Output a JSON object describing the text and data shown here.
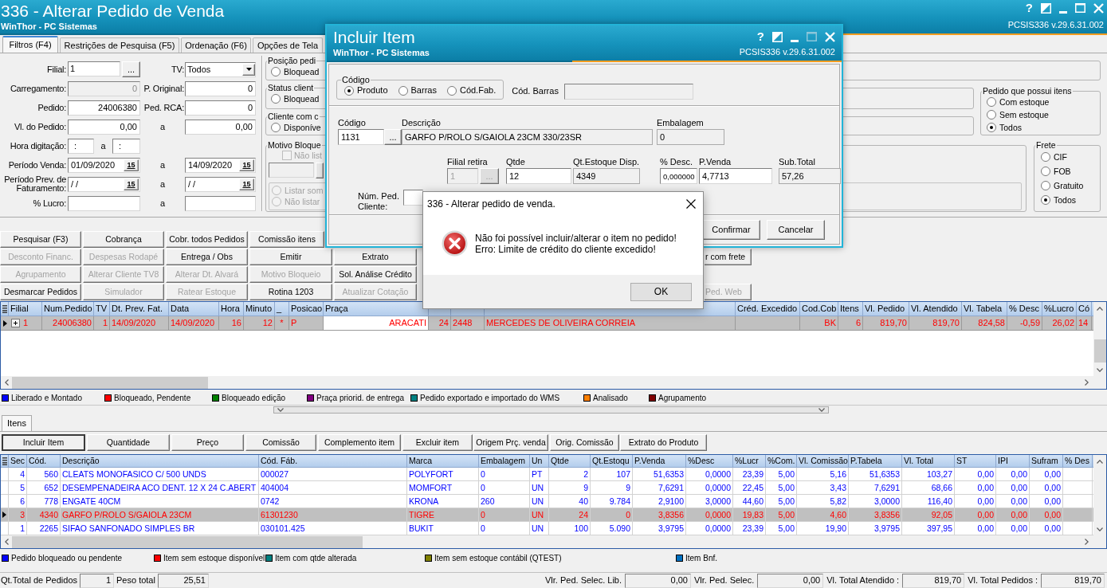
{
  "window": {
    "title": "336 - Alterar Pedido de Venda",
    "subtitle": "WinThor - PC Sistemas",
    "help": "?",
    "buttons": [
      {
        "kind": "restore",
        "disabled": false
      },
      {
        "kind": "minimize",
        "disabled": false
      },
      {
        "kind": "maximize",
        "disabled": false
      },
      {
        "kind": "close",
        "disabled": false
      }
    ],
    "version": "PCSIS336 v.29.6.31.002"
  },
  "tabs": [
    {
      "label": "Filtros (F4)",
      "selected": true
    },
    {
      "label": "Restrições de Pesquisa (F5)",
      "selected": false
    },
    {
      "label": "Ordenação (F6)",
      "selected": false
    },
    {
      "label": "Opções de Tela",
      "selected": false
    }
  ],
  "filters": [
    {
      "left": {
        "label": "Filial:",
        "kind": "lookup",
        "value": "1",
        "button": "...",
        "disabled": false
      },
      "right": {
        "label": "TV:",
        "kind": "select",
        "value": "Todos",
        "disabled": false,
        "range_end": false
      }
    },
    {
      "left": {
        "label": "Carregamento:",
        "kind": "number",
        "value": "0",
        "disabled": true
      },
      "right": {
        "label": "P. Original:",
        "kind": "number",
        "value": "0",
        "disabled": false,
        "range_end": false
      }
    },
    {
      "left": {
        "label": "Pedido:",
        "kind": "number",
        "value": "24006380",
        "disabled": false
      },
      "right": {
        "label": "Ped. RCA:",
        "kind": "number",
        "value": "0",
        "disabled": false,
        "range_end": false
      }
    },
    {
      "left": {
        "label": "Vl. do Pedido:",
        "kind": "number",
        "value": "0,00",
        "disabled": false
      },
      "right": {
        "label": "a",
        "kind": "number",
        "value": "0,00",
        "disabled": false,
        "range_end": true
      }
    },
    {
      "left": {
        "label": "Hora digitação:",
        "kind": "time",
        "value": ":",
        "to_label": "a",
        "to_value": ":",
        "disabled": false
      }
    },
    {
      "left": {
        "label": "Período Venda:",
        "kind": "date",
        "value": "01/09/2020",
        "button": "15",
        "disabled": false
      },
      "right": {
        "label": "a",
        "kind": "date",
        "value": "14/09/2020",
        "button": "15",
        "disabled": false,
        "range_end": true
      }
    },
    {
      "left": {
        "label": "Período Prev. de Faturamento:",
        "kind": "date",
        "value": "/ /",
        "button": "15",
        "disabled": false
      },
      "right": {
        "label": "a",
        "kind": "date",
        "value": "/ /",
        "button": "15",
        "disabled": false,
        "range_end": true
      }
    },
    {
      "left": {
        "label": "% Lucro:",
        "kind": "number",
        "disabled": false
      },
      "right": {
        "label": "a",
        "kind": "number",
        "disabled": false,
        "range_end": true
      }
    }
  ],
  "status_groups": [
    {
      "title": "Posição pedi",
      "options": [
        {
          "label": "Bloquead",
          "selected": false
        }
      ]
    },
    {
      "title": "Status client",
      "options": [
        {
          "label": "Bloquead",
          "selected": false
        }
      ]
    },
    {
      "title": "Cliente com c",
      "options": [
        {
          "label": "Disponíve",
          "selected": false
        }
      ]
    }
  ],
  "block_reason": {
    "title": "Motivo Bloque",
    "checkbox": {
      "label": "Não list",
      "checked": false,
      "disabled": true
    },
    "field": {
      "disabled": true
    },
    "options": [
      {
        "label": "Listar som",
        "selected": false,
        "disabled": true
      },
      {
        "label": "Não listar",
        "selected": false,
        "disabled": true
      }
    ]
  },
  "stock_group": {
    "title": "Pedido que possui itens",
    "options": [
      {
        "label": "Com estoque",
        "selected": false
      },
      {
        "label": "Sem estoque",
        "selected": false
      },
      {
        "label": "Todos",
        "selected": true
      }
    ]
  },
  "freight_group": {
    "title": "Frete",
    "options": [
      {
        "label": "CIF",
        "selected": false
      },
      {
        "label": "FOB",
        "selected": false
      },
      {
        "label": "Gratuito",
        "selected": false
      },
      {
        "label": "Todos",
        "selected": true
      }
    ]
  },
  "action_rows": [
    {
      "buttons": [
        {
          "label": "Pesquisar (F3)",
          "disabled": false,
          "kind": "full"
        },
        {
          "label": "Cobrança",
          "disabled": false,
          "kind": "full"
        },
        {
          "label": "Cobr. todos Pedidos",
          "disabled": false,
          "kind": "full"
        },
        {
          "label": "Comissão itens",
          "disabled": false,
          "kind": "full"
        }
      ]
    },
    {
      "buttons": [
        {
          "label": "Desconto Financ.",
          "disabled": true,
          "kind": "full"
        },
        {
          "label": "Despesas Rodapé",
          "disabled": true,
          "kind": "full"
        },
        {
          "label": "Entrega / Obs",
          "disabled": false,
          "kind": "full"
        },
        {
          "label": "Emitir",
          "disabled": false,
          "kind": "full"
        },
        {
          "label": "Extrato",
          "disabled": false,
          "kind": "full"
        },
        {
          "label": "r com frete",
          "disabled": false,
          "kind": "cut"
        }
      ]
    },
    {
      "buttons": [
        {
          "label": "Agrupamento",
          "disabled": true,
          "kind": "full"
        },
        {
          "label": "Alterar Cliente TV8",
          "disabled": true,
          "kind": "full"
        },
        {
          "label": "Alterar Dt. Alvará",
          "disabled": true,
          "kind": "full"
        },
        {
          "label": "Motivo Bloqueio",
          "disabled": true,
          "kind": "full"
        },
        {
          "label": "Sol. Análise Crédito",
          "disabled": false,
          "kind": "full"
        }
      ]
    },
    {
      "buttons": [
        {
          "label": "Desmarcar Pedidos",
          "disabled": false,
          "kind": "full"
        },
        {
          "label": "Simulador",
          "disabled": true,
          "kind": "full"
        },
        {
          "label": "Ratear Estoque",
          "disabled": true,
          "kind": "full"
        },
        {
          "label": "Rotina 1203",
          "disabled": false,
          "kind": "full"
        },
        {
          "label": "Atualizar Cotação",
          "disabled": true,
          "kind": "full"
        },
        {
          "label": "Ped. Web",
          "disabled": true,
          "kind": "cut"
        }
      ]
    }
  ],
  "orders": {
    "columns": [
      "Filial",
      "Num.Pedido",
      "TV",
      "Dt. Prev. Fat.",
      "Data",
      "Hora",
      "Minuto",
      "_",
      "Posicao",
      "Praça",
      null,
      null,
      null,
      "Créd. Excedido",
      "Cod.Cob",
      "Itens",
      "Vl. Pedido",
      "Vl. Atendido",
      "Vl. Tabela",
      "% Desc",
      "%Lucro",
      "Có"
    ],
    "rows": [
      {
        "selected": true,
        "color": "#ff0000",
        "cells": [
          {
            "text": "1",
            "focused": false
          },
          {
            "text": "24006380",
            "focused": false
          },
          {
            "text": "1",
            "focused": false
          },
          {
            "text": "14/09/2020",
            "focused": false
          },
          {
            "text": "14/09/2020",
            "focused": false
          },
          {
            "text": "16",
            "focused": false
          },
          {
            "text": "12",
            "focused": false
          },
          {
            "text": "*",
            "focused": false
          },
          {
            "text": "P",
            "focused": false
          },
          {
            "text": "ARACATI",
            "focused": true
          },
          {
            "text": "24",
            "focused": false
          },
          {
            "text": "2448",
            "focused": false
          },
          {
            "text": "MERCEDES DE OLIVEIRA CORREIA",
            "focused": false
          },
          {
            "focused": false
          },
          {
            "text": "BK",
            "focused": false
          },
          {
            "text": "6",
            "focused": false
          },
          {
            "text": "819,70",
            "focused": false
          },
          {
            "text": "819,70",
            "focused": false
          },
          {
            "text": "824,58",
            "focused": false
          },
          {
            "text": "-0,59",
            "focused": false
          },
          {
            "text": "26,02",
            "focused": false
          },
          {
            "text": "14",
            "focused": false
          }
        ]
      }
    ]
  },
  "order_legend": [
    {
      "label": "Liberado e Montado",
      "color": "#0000ff"
    },
    {
      "label": "Bloqueado, Pendente",
      "color": "#ff0000"
    },
    {
      "label": "Bloqueado edição",
      "color": "#008000"
    },
    {
      "label": "Praça priorid. de entrega",
      "color": "#800080"
    },
    {
      "label": "Pedido exportado e importado do WMS",
      "color": "#008080"
    },
    {
      "label": "Analisado",
      "color": "#ff8000"
    },
    {
      "label": "Agrupamento",
      "color": "#800000"
    }
  ],
  "item_tabs": [
    {
      "label": "Itens",
      "selected": true
    }
  ],
  "item_actions": [
    {
      "label": "Incluir Item",
      "default": true
    },
    {
      "label": "Quantidade",
      "default": false
    },
    {
      "label": "Preço",
      "default": false
    },
    {
      "label": "Comissão",
      "default": false
    },
    {
      "label": "Complemento item",
      "default": false
    },
    {
      "label": "Excluir item",
      "default": false
    },
    {
      "label": "Origem Prç. venda",
      "default": false
    },
    {
      "label": "Orig. Comissão",
      "default": false
    },
    {
      "label": "Extrato do Produto",
      "default": false
    }
  ],
  "items": {
    "columns": [
      "Sec",
      "Cód.",
      "Descrição",
      "Cód. Fáb.",
      "Marca",
      "Embalagem",
      "Un",
      "Qtde",
      "Qt.Estoqu",
      "P.Venda",
      "%Desc",
      "%Lucr",
      "%Com.",
      "Vl. Comissão",
      "P.Tabela",
      "Vl. Total",
      "ST",
      "IPI",
      "Sufram",
      "% Des"
    ],
    "rows": [
      {
        "selected": false,
        "color": "#0000ff",
        "cells": [
          "4",
          "560",
          "CLEATS MONOFASICO C/ 500 UNDS",
          "000027",
          "POLYFORT",
          "0",
          "PT",
          "2",
          "107",
          "51,6353",
          "0,0000",
          "23,39",
          "5,00",
          "5,16",
          "51,6353",
          "103,27",
          "0,00",
          "0,00",
          "0,00",
          null
        ]
      },
      {
        "selected": false,
        "color": "#0000ff",
        "cells": [
          "5",
          "652",
          "DESEMPENADEIRA ACO DENT. 12 X 24 C.ABERT",
          "404004",
          "MOMFORT",
          "0",
          "UN",
          "9",
          "9",
          "7,6291",
          "0,0000",
          "22,45",
          "5,00",
          "3,43",
          "7,6291",
          "68,66",
          "0,00",
          "0,00",
          "0,00",
          null
        ]
      },
      {
        "selected": false,
        "color": "#0000ff",
        "cells": [
          "6",
          "778",
          "ENGATE 40CM",
          "0742",
          "KRONA",
          "260",
          "UN",
          "40",
          "9.784",
          "2,9100",
          "3,0000",
          "44,60",
          "5,00",
          "5,82",
          "3,0000",
          "116,40",
          "0,00",
          "0,00",
          "0,00",
          null
        ]
      },
      {
        "selected": true,
        "color": "#ff0000",
        "cells": [
          "3",
          "4340",
          "GARFO P/ROLO S/GAIOLA 23CM",
          "61301230",
          "TIGRE",
          "0",
          "UN",
          "24",
          "0",
          "3,8356",
          "0,0000",
          "19,83",
          "5,00",
          "4,60",
          "3,8356",
          "92,05",
          "0,00",
          "0,00",
          "0,00",
          null
        ]
      },
      {
        "selected": false,
        "color": "#0000ff",
        "cells": [
          "1",
          "2265",
          "SIFAO SANFONADO SIMPLES BR",
          "030101.425",
          "BUKIT",
          "0",
          "UN",
          "100",
          "5.090",
          "3,9795",
          "0,0000",
          "23,39",
          "5,00",
          "19,90",
          "3,9795",
          "397,95",
          "0,00",
          "0,00",
          "0,00",
          null
        ]
      }
    ]
  },
  "item_legend": [
    {
      "label": "Pedido bloqueado ou pendente",
      "color": "#0000ff"
    },
    {
      "label": "Item sem estoque disponível",
      "color": "#ff0000"
    },
    {
      "label": "Item com qtde alterada",
      "color": "#008080"
    },
    {
      "label": "Item sem estoque contábil (QTEST)",
      "color": "#808000"
    },
    {
      "label": "Item Bnf.",
      "color": "#0070c0"
    }
  ],
  "totals": {
    "left": [
      {
        "label": "Qt.Total de Pedidos",
        "value": "1"
      },
      {
        "label": "Peso total",
        "value": "25,51"
      }
    ],
    "right": [
      {
        "label": "Vlr. Ped. Selec. Lib.",
        "value": "0,00"
      },
      {
        "label": "Vlr. Ped. Selec.",
        "value": "0,00"
      },
      {
        "label": "Vl. Total Atendido :",
        "value": "819,70"
      },
      {
        "label": "Vl. Total Pedidos :",
        "value": "819,70"
      }
    ]
  },
  "dialog": {
    "title": "Incluir Item",
    "subtitle": "WinThor - PC Sistemas",
    "help": "?",
    "buttons": [
      {
        "kind": "restore",
        "disabled": false
      },
      {
        "kind": "minimize",
        "disabled": false
      },
      {
        "kind": "maximize",
        "disabled": true
      },
      {
        "kind": "close",
        "disabled": false
      }
    ],
    "version": "PCSIS336 v.29.6.31.002",
    "code_group": {
      "title": "Código",
      "options": [
        {
          "label": "Produto",
          "selected": true
        },
        {
          "label": "Barras",
          "selected": false
        },
        {
          "label": "Cód.Fab.",
          "selected": false
        }
      ]
    },
    "barcode": {
      "label": "Cód. Barras",
      "disabled": true
    },
    "product_row": [
      {
        "label": "Código",
        "value": "1131",
        "kind": "lookup",
        "button": "...",
        "readonly": false,
        "disabled": false
      },
      {
        "label": "Descrição",
        "value": "GARFO P/ROLO S/GAIOLA 23CM 330/23SR",
        "kind": "text",
        "readonly": true,
        "disabled": false
      },
      {
        "label": "Embalagem",
        "value": "0",
        "kind": "text",
        "readonly": true,
        "disabled": false
      }
    ],
    "price_row": [
      {
        "label": "Filial retira",
        "value": "1",
        "kind": "lookup",
        "button": "...",
        "readonly": false,
        "disabled": true
      },
      {
        "label": "Qtde",
        "value": "12",
        "kind": "text",
        "readonly": false,
        "disabled": false
      },
      {
        "label": "Qt.Estoque Disp.",
        "value": "4349",
        "kind": "text",
        "readonly": true,
        "disabled": false
      },
      {
        "label": "% Desc.",
        "value": "0,000000",
        "kind": "small",
        "readonly": false,
        "disabled": false
      },
      {
        "label": "P.Venda",
        "value": "4,7713",
        "kind": "text",
        "readonly": false,
        "disabled": false
      },
      {
        "label": "Sub.Total",
        "value": "57,26",
        "kind": "text",
        "readonly": true,
        "disabled": false
      }
    ],
    "customer_order": {
      "label": "Núm. Ped. Cliente:"
    },
    "buttons_bottom": [
      {
        "label": "Confirmar"
      },
      {
        "label": "Cancelar"
      }
    ]
  },
  "message_box": {
    "title": "336 - Alterar pedido de venda.",
    "message": "Não foi possível incluir/alterar o item no pedido!\nErro: Limite de crédito do cliente excedido!",
    "button": "OK"
  }
}
